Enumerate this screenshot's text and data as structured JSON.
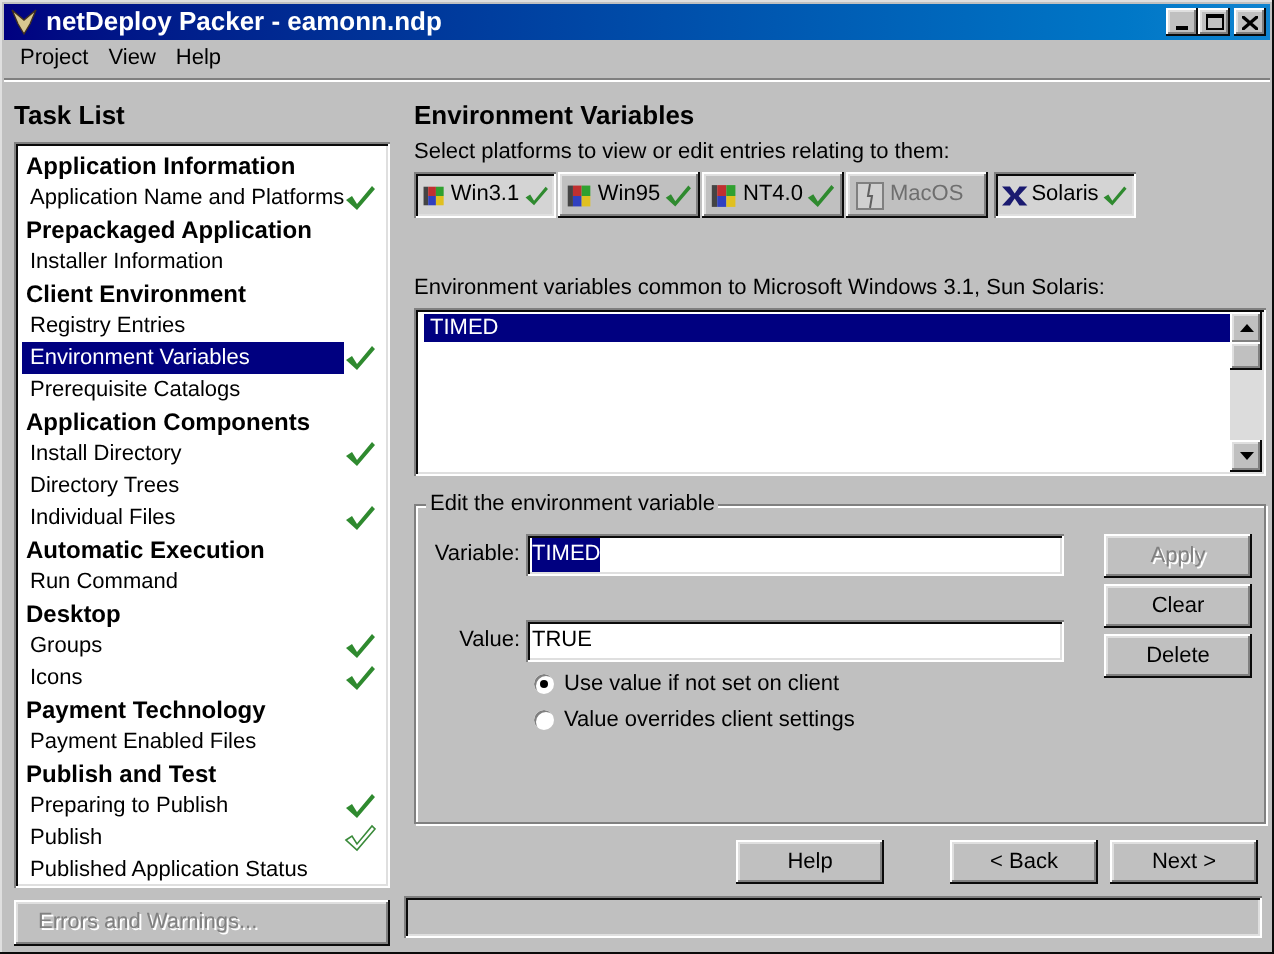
{
  "window": {
    "title": "netDeploy Packer - eamonn.ndp"
  },
  "menu": [
    "Project",
    "View",
    "Help"
  ],
  "task_list": {
    "title": "Task List",
    "groups": [
      {
        "label": "Application Information",
        "items": [
          {
            "label": "Application Name and Platforms",
            "selected": false,
            "checked": true,
            "kind": "solid"
          }
        ]
      },
      {
        "label": "Prepackaged Application",
        "items": [
          {
            "label": "Installer Information",
            "selected": false,
            "checked": false,
            "kind": "solid"
          }
        ]
      },
      {
        "label": "Client Environment",
        "items": [
          {
            "label": "Registry Entries",
            "selected": false,
            "checked": false,
            "kind": "solid"
          },
          {
            "label": "Environment Variables",
            "selected": true,
            "checked": true,
            "kind": "solid"
          },
          {
            "label": "Prerequisite Catalogs",
            "selected": false,
            "checked": false,
            "kind": "solid"
          }
        ]
      },
      {
        "label": "Application Components",
        "items": [
          {
            "label": "Install Directory",
            "selected": false,
            "checked": true,
            "kind": "solid"
          },
          {
            "label": "Directory Trees",
            "selected": false,
            "checked": false,
            "kind": "solid"
          },
          {
            "label": "Individual Files",
            "selected": false,
            "checked": true,
            "kind": "solid"
          }
        ]
      },
      {
        "label": "Automatic Execution",
        "items": [
          {
            "label": "Run Command",
            "selected": false,
            "checked": false,
            "kind": "solid"
          }
        ]
      },
      {
        "label": "Desktop",
        "items": [
          {
            "label": "Groups",
            "selected": false,
            "checked": true,
            "kind": "solid"
          },
          {
            "label": "Icons",
            "selected": false,
            "checked": true,
            "kind": "solid"
          }
        ]
      },
      {
        "label": "Payment Technology",
        "items": [
          {
            "label": "Payment Enabled Files",
            "selected": false,
            "checked": false,
            "kind": "solid"
          }
        ]
      },
      {
        "label": "Publish and Test",
        "items": [
          {
            "label": "Preparing to Publish",
            "selected": false,
            "checked": true,
            "kind": "solid"
          },
          {
            "label": "Publish",
            "selected": false,
            "checked": true,
            "kind": "outline"
          },
          {
            "label": "Published Application Status",
            "selected": false,
            "checked": false,
            "kind": "solid"
          }
        ]
      }
    ]
  },
  "errors_button": {
    "label": "Errors and Warnings...",
    "disabled": true
  },
  "panel": {
    "title": "Environment Variables",
    "platform_prompt": "Select platforms to view or edit entries relating to them:",
    "platforms": [
      {
        "label": "Win3.1",
        "kind": "windows",
        "selected": true,
        "disabled": false,
        "checked": true
      },
      {
        "label": "Win95",
        "kind": "windows",
        "selected": false,
        "disabled": false,
        "checked": true
      },
      {
        "label": "NT4.0",
        "kind": "windows",
        "selected": false,
        "disabled": false,
        "checked": true
      },
      {
        "label": "MacOS",
        "kind": "mac",
        "selected": false,
        "disabled": true,
        "checked": false
      },
      {
        "label": "Solaris",
        "kind": "x",
        "selected": true,
        "disabled": false,
        "checked": true
      }
    ],
    "list_label": "Environment variables common to Microsoft Windows 3.1, Sun Solaris:",
    "list_items": [
      {
        "label": "TIMED",
        "selected": true
      }
    ],
    "edit_group": {
      "title": "Edit the environment variable",
      "variable": {
        "label": "Variable:",
        "value": "TIMED",
        "highlighted": true
      },
      "value": {
        "label": "Value:",
        "value": "TRUE",
        "highlighted": false
      },
      "options": [
        {
          "label": "Use value if not set on client",
          "selected": true
        },
        {
          "label": "Value overrides client settings",
          "selected": false
        }
      ],
      "buttons": [
        {
          "label": "Apply",
          "disabled": true
        },
        {
          "label": "Clear",
          "disabled": false
        },
        {
          "label": "Delete",
          "disabled": false
        }
      ]
    }
  },
  "footer_buttons": [
    {
      "label": "Help"
    },
    {
      "label": "< Back"
    },
    {
      "label": "Next >"
    }
  ]
}
